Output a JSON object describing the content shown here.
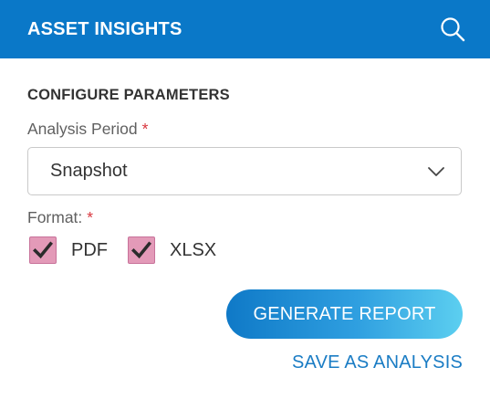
{
  "header": {
    "title": "ASSET INSIGHTS",
    "search_icon": "search-icon"
  },
  "form": {
    "section_title": "CONFIGURE PARAMETERS",
    "period": {
      "label": "Analysis Period",
      "required_mark": "*",
      "value": "Snapshot",
      "dropdown_icon": "chevron-down-icon"
    },
    "format": {
      "label": "Format:",
      "required_mark": "*",
      "options": [
        {
          "label": "PDF",
          "checked": true
        },
        {
          "label": "XLSX",
          "checked": true
        }
      ]
    }
  },
  "actions": {
    "generate_label": "GENERATE REPORT",
    "save_label": "SAVE AS ANALYSIS"
  },
  "colors": {
    "header_bg": "#0a78c8",
    "checkbox_fill": "#e39ab8",
    "required": "#d9363e",
    "link": "#1a7cc4"
  }
}
